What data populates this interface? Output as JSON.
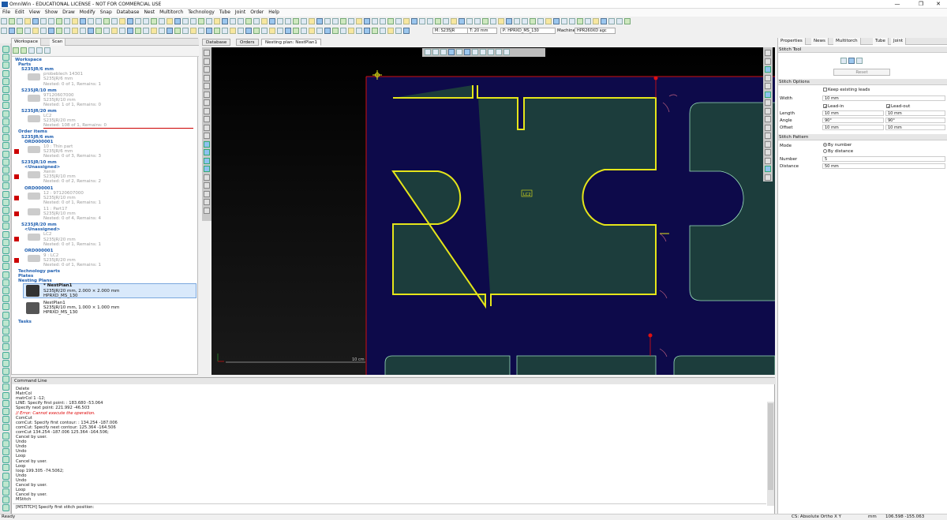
{
  "window": {
    "title": "OmniWin - EDUCATIONAL LICENSE - NOT FOR COMMERCIAL USE",
    "minimize": "—",
    "restore": "❐",
    "close": "✕"
  },
  "menu": [
    "File",
    "Edit",
    "View",
    "Show",
    "Draw",
    "Modify",
    "Snap",
    "Database",
    "Nest",
    "Multitorch",
    "Technology",
    "Tube",
    "Joint",
    "Order",
    "Help"
  ],
  "toolbar": {
    "material": "M: S235JR",
    "thickness": "T: 20 mm",
    "profile": "P: HPRXD_MS_130",
    "machine_label": "Machine:",
    "machine": "HPR260XD agc"
  },
  "left_panel": {
    "tabs": [
      "Workspace",
      "Scan"
    ],
    "workspace": "Workspace",
    "parts": "Parts",
    "groups": [
      {
        "header": "S235JR/6 mm",
        "items": [
          {
            "name": "probeblech 14301",
            "mat": "S235JR/6 mm",
            "status": "Nested: 0 of 1, Remains: 1"
          }
        ]
      },
      {
        "header": "S235JR/10 mm",
        "items": [
          {
            "name": "97120607000",
            "mat": "S235JR/10 mm",
            "status": "Nested: 1 of 1, Remains: 0"
          }
        ]
      },
      {
        "header": "S235JR/20 mm",
        "items": [
          {
            "name": "LC2",
            "mat": "S235JR/20 mm",
            "status": "Nested: 108 of 1, Remains: 0"
          }
        ]
      }
    ],
    "order_items": "Order items",
    "order_groups": [
      {
        "header": "S235JR/6 mm",
        "sub": "ORD000001",
        "items": [
          {
            "name": "10 : Thin part",
            "mat": "S235JR/6 mm",
            "status": "Nested: 0 of 3, Remains: 3"
          }
        ]
      },
      {
        "header": "S235JR/10 mm",
        "sub": "<Unassigned>",
        "items": [
          {
            "name": "Xenin",
            "mat": "S235JR/10 mm",
            "status": "Nested: 0 of 2, Remains: 2"
          }
        ]
      },
      {
        "header": "",
        "sub": "ORD000001",
        "items": [
          {
            "name": "12 : 97120607000",
            "mat": "S235JR/10 mm",
            "status": "Nested: 0 of 1, Remains: 1"
          },
          {
            "name": "11 : Part17",
            "mat": "S235JR/10 mm",
            "status": "Nested: 0 of 4, Remains: 4"
          }
        ]
      },
      {
        "header": "S235JR/20 mm",
        "sub": "<Unassigned>",
        "items": [
          {
            "name": "LC2",
            "mat": "S235JR/20 mm",
            "status": "Nested: 0 of 1, Remains: 1"
          }
        ]
      },
      {
        "header": "",
        "sub": "ORD000001",
        "items": [
          {
            "name": "9 : LC2",
            "mat": "S235JR/20 mm",
            "status": "Nested: 0 of 1, Remains: 1"
          }
        ]
      }
    ],
    "technology_parts": "Technology parts",
    "plates": "Plates",
    "nesting_plans": "Nesting Plans",
    "plans": [
      {
        "name": "* NestPlan1",
        "detail": "S235JR/20 mm, 2.000 × 2.000 mm",
        "tech": "HPRXD_MS_130"
      },
      {
        "name": "NestPlan1",
        "detail": "S235JR/10 mm, 1.000 × 1.000 mm",
        "tech": "HPRXD_MS_130"
      }
    ],
    "tasks": "Tasks"
  },
  "center": {
    "tabs": [
      "Database",
      "Orders",
      "Nesting plan: NestPlan1"
    ],
    "scale_label": "10 cm",
    "part_label": "LC2",
    "colors": {
      "bg": "#0d0a4a",
      "part_fill": "#1c3d3c",
      "contour": "#e5e51a",
      "plate_edge": "#d01010"
    }
  },
  "properties": {
    "tabs": [
      "Properties",
      "News",
      "Multitorch",
      "Tube",
      "Joint"
    ],
    "stitch_tool": "Stitch Tool",
    "reset": "Reset",
    "stitch_options": "Stitch Options",
    "keep_leads": "Keep existing leads",
    "width_label": "Width",
    "width": "10 mm",
    "lead_in": "Lead-in",
    "lead_out": "Lead-out",
    "length_label": "Length",
    "length_in": "10 mm",
    "length_out": "10 mm",
    "angle_label": "Angle",
    "angle_in": "90°",
    "angle_out": "90°",
    "offset_label": "Offset",
    "offset_in": "10 mm",
    "offset_out": "10 mm",
    "stitch_pattern": "Stitch Pattern",
    "mode_label": "Mode",
    "by_number": "By number",
    "by_distance": "By distance",
    "number_label": "Number",
    "number": "5",
    "distance_label": "Distance",
    "distance": "50 mm"
  },
  "command": {
    "title": "Command Line",
    "lines": [
      {
        "t": "Delete",
        "err": false
      },
      {
        "t": "MatrCol",
        "err": false
      },
      {
        "t": "matrCol 1 -12;",
        "err": false
      },
      {
        "t": "LINE: Specify first point: : 183.680 -53.064",
        "err": false
      },
      {
        "t": "Specify next point: 221.992 -46.503",
        "err": false
      },
      {
        "t": "// Error: Cannot execute the operation.",
        "err": true
      },
      {
        "t": "ComCut",
        "err": false
      },
      {
        "t": "comCut: Specify first contour: : 134.254 -187.006",
        "err": false
      },
      {
        "t": "comCut: Specify next contour: 125.364 -164.506",
        "err": false
      },
      {
        "t": "comCut 134.254 -187.006 125.364 -164.506;",
        "err": false
      },
      {
        "t": "Cancel by user.",
        "err": false
      },
      {
        "t": "Undo",
        "err": false
      },
      {
        "t": "Undo",
        "err": false
      },
      {
        "t": "Undo",
        "err": false
      },
      {
        "t": "Loop",
        "err": false
      },
      {
        "t": "Cancel by user.",
        "err": false
      },
      {
        "t": "Loop",
        "err": false
      },
      {
        "t": "loop 199.305 -74.5062;",
        "err": false
      },
      {
        "t": "Undo",
        "err": false
      },
      {
        "t": "Undo",
        "err": false
      },
      {
        "t": "Cancel by user.",
        "err": false
      },
      {
        "t": "Loop",
        "err": false
      },
      {
        "t": "Cancel by user.",
        "err": false
      },
      {
        "t": "MStitch",
        "err": false
      }
    ],
    "prompt": "[MSTITCH] Specify first stitch position:"
  },
  "status": {
    "left": "Ready",
    "cs": "CS: Absolute Ortho X Y",
    "unit": "mm",
    "coords": "106.598 -155.063"
  }
}
